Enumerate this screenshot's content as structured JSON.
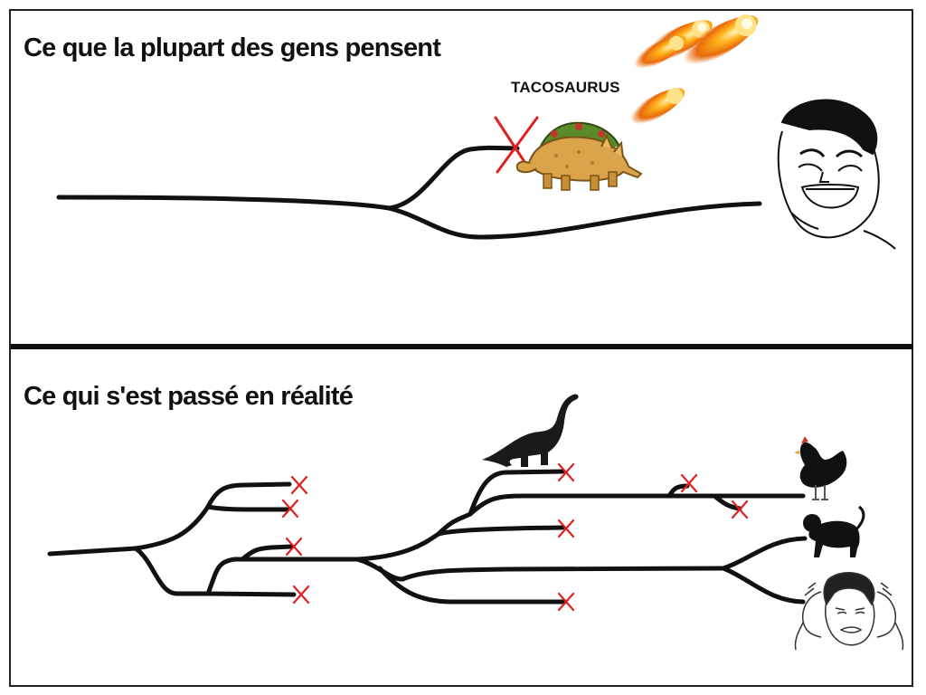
{
  "panels": {
    "top": {
      "title": "Ce que la plupart des gens pensent",
      "dinosaur_label": "TACOSAURUS"
    },
    "bottom": {
      "title": "Ce qui s'est passé en réalité"
    }
  },
  "colors": {
    "line": "#111111",
    "extinct_mark": "#e02020",
    "frame": "#222222"
  },
  "icons": {
    "top": [
      "meteor-icon",
      "tacosaurus-icon",
      "laughing-face-icon"
    ],
    "bottom": [
      "sauropod-icon",
      "chicken-icon",
      "monkey-icon",
      "stressed-face-icon"
    ]
  }
}
